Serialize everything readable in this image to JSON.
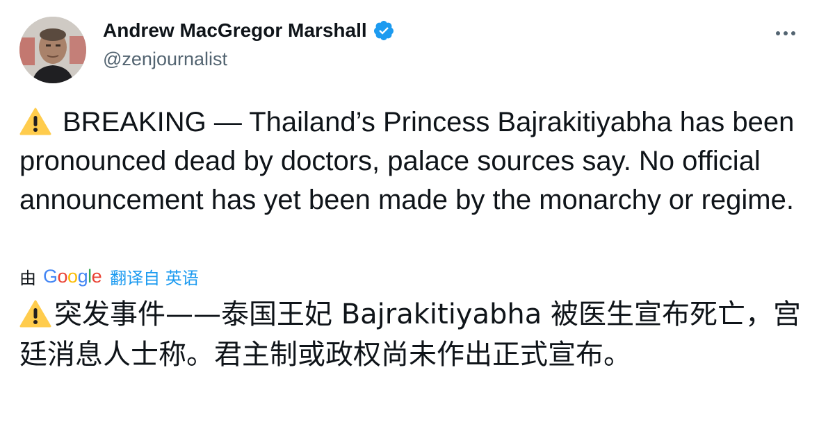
{
  "author": {
    "display_name": "Andrew MacGregor Marshall",
    "handle": "@zenjournalist",
    "verified": true
  },
  "tweet": {
    "text": "BREAKING — Thailand’s Princess Bajrakitiyabha has been pronounced dead by doctors, palace sources say. No official announcement has yet been made by the monarchy or regime.",
    "leading_icon": "warning-icon"
  },
  "translation": {
    "by_label": "由",
    "provider_letters": [
      "G",
      "o",
      "o",
      "g",
      "l",
      "e"
    ],
    "provider_colors": [
      "#4285f4",
      "#ea4335",
      "#fbbc05",
      "#4285f4",
      "#34a853",
      "#ea4335"
    ],
    "link_label": "翻译自 英语",
    "text": "突发事件——泰国王妃 Bajrakitiyabha 被医生宣布死亡，宫廷消息人士称。君主制或政权尚未作出正式宣布。"
  },
  "icons": {
    "verified": "verified-badge-icon",
    "more": "more-options-icon",
    "warning": "warning-icon"
  },
  "colors": {
    "accent": "#1d9bf0",
    "text_primary": "#0f1419",
    "text_secondary": "#536471"
  }
}
